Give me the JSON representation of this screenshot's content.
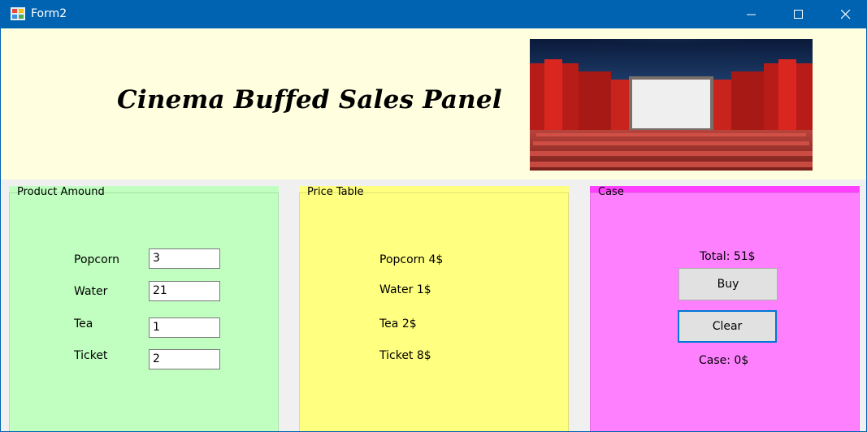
{
  "window": {
    "title": "Form2",
    "controls": {
      "minimize": "minimize",
      "maximize": "maximize",
      "close": "close"
    }
  },
  "header": {
    "heading": "Cinema Buffed Sales Panel",
    "image_icon": "cinema-hall-image"
  },
  "product_group": {
    "legend": "Product Amound",
    "rows": [
      {
        "label": "Popcorn",
        "value": "3"
      },
      {
        "label": "Water",
        "value": "21"
      },
      {
        "label": "Tea",
        "value": "1"
      },
      {
        "label": "Ticket",
        "value": "2"
      }
    ]
  },
  "price_group": {
    "legend": "Price Table",
    "items": [
      "Popcorn 4$",
      "Water 1$",
      "Tea 2$",
      "Ticket 8$"
    ]
  },
  "case_group": {
    "legend": "Case",
    "total_text": "Total: 51$",
    "buy_label": "Buy",
    "clear_label": "Clear",
    "case_text": "Case: 0$"
  },
  "colors": {
    "titlebar": "#0063b1",
    "header_bg": "#ffffe0",
    "product_bg": "#c0ffc0",
    "price_bg": "#ffff80",
    "case_bg": "#ff80ff"
  }
}
